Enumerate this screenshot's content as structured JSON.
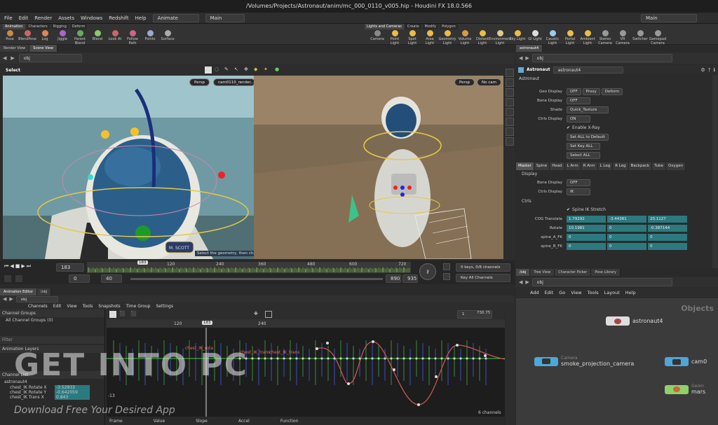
{
  "window": {
    "title": "/Volumes/Projects/Astronaut/anim/mc_000_0110_v005.hip - Houdini FX 18.0.566"
  },
  "menu": {
    "items": [
      "File",
      "Edit",
      "Render",
      "Assets",
      "Windows",
      "Redshift",
      "Help"
    ],
    "desktop": "Animate",
    "main_left": "Main",
    "main_right": "Main"
  },
  "shelf": {
    "tabs_left": [
      "Animation",
      "Characters",
      "Rigging",
      "Deform"
    ],
    "tools_left": [
      "Pose",
      "BlendPose",
      "Log",
      "Jiggle",
      "Parent Blend",
      "Blend",
      "Look At",
      "Follow Path",
      "Points",
      "Surface"
    ],
    "tabs_right": [
      "Lights and Cameras",
      "Create",
      "Modify",
      "Polygon"
    ],
    "tools_right": [
      "Camera",
      "Point Light",
      "Spot Light",
      "Area Light",
      "Geometry Light",
      "Volume Light",
      "Distant Light",
      "Environment Light",
      "Sky Light",
      "GI Light",
      "Caustic Light",
      "Portal Light",
      "Ambient Light",
      "Stereo Camera",
      "VR Camera",
      "Switcher",
      "Gamepad Camera"
    ]
  },
  "viewport": {
    "tabs": [
      "Render View",
      "Scene View"
    ],
    "path": "obj",
    "mode": "Select",
    "left_persp": "Persp",
    "left_cam": "cam0110_render...",
    "right_persp": "Persp",
    "right_cam": "No cam",
    "status": "Select the geometry, then choose an operation to perform."
  },
  "timeline": {
    "current_frame": "183",
    "ticks": [
      "120",
      "240",
      "360",
      "480",
      "600",
      "720"
    ],
    "start": "0",
    "start2": "40",
    "end1": "890",
    "end2": "935",
    "keys_info": "0 keys, 0/6 channels",
    "key_all": "Key All Channels"
  },
  "anim_editor": {
    "tabs": [
      "Animation Editor",
      "/obj"
    ],
    "path": "obj",
    "menu": [
      "Channels",
      "Edit",
      "View",
      "Tools",
      "Snapshots",
      "Time Group",
      "Settings"
    ],
    "channel_groups": "Channel Groups",
    "all_groups": "All Channel Groups (0)",
    "filter": "Filter",
    "layers": "Animation Layers",
    "channel_list": "Channel List",
    "node": "astronaut4",
    "channels": [
      {
        "name": "chest_IK Rotate X",
        "value": "-3.52933"
      },
      {
        "name": "chest_IK Rotate Y",
        "value": "-0.642059"
      },
      {
        "name": "chest_IK Trans X",
        "value": "0.843"
      }
    ],
    "graph_start": "1",
    "graph_end": "730.75",
    "graph_frame": "183",
    "graph_ticks": [
      "120",
      "240"
    ],
    "curve_label1": "chest_IK_rota",
    "curve_label2": "chest_IK_trans",
    "curve_label3": "chest_IK_trans",
    "y_value": "-13",
    "channel_count": "6 channels",
    "bottom": [
      "Frame",
      "Value",
      "Slope",
      "Accel",
      "Function"
    ]
  },
  "params": {
    "tab": "astronaut4",
    "type": "Astronaut",
    "node": "astronaut4",
    "section": "Astronaut",
    "geo_display_label": "Geo Display",
    "geo_display": [
      "OFF",
      "Proxy",
      "Deform"
    ],
    "bone_display_label": "Bone Display",
    "bone_display": "OFF",
    "shade_label": "Shade",
    "shade": "Quick_Texture",
    "ctrls_display_label": "Ctrls Display",
    "ctrls_display": "ON",
    "xray": "Enable X-Ray",
    "set_all_default": "Set ALL to Default",
    "set_key_all": "Set Key ALL",
    "select_all": "Select ALL",
    "tabs": [
      "Master",
      "Spine",
      "Head",
      "L Arm",
      "R Arm",
      "L Leg",
      "R Leg",
      "Backpack",
      "Tube",
      "Oxygen"
    ],
    "display_section": "Display",
    "bone_display2": "OFF",
    "ctrls_display2": "IK",
    "ctrls_section": "Ctrls",
    "spine_ik": "Spine IK Stretch",
    "cog_translate": {
      "label": "COG Translate",
      "x": "1.79292",
      "y": "-3.44381",
      "z": "20.1127"
    },
    "rotate": {
      "label": "Rotate",
      "x": "10.1981",
      "y": "0",
      "z": "-0.387144"
    },
    "spine_a": {
      "label": "spine_A_FK",
      "x": "0",
      "y": "0",
      "z": "0"
    },
    "spine_b": {
      "label": "spine_B_FK",
      "x": "0",
      "y": "0",
      "z": "0"
    }
  },
  "network": {
    "tabs": [
      "/obj",
      "Tree View",
      "Character Picker",
      "Pose Library"
    ],
    "path": "obj",
    "menu": [
      "Add",
      "Edit",
      "Go",
      "View",
      "Tools",
      "Layout",
      "Help"
    ],
    "title": "Objects",
    "nodes": [
      {
        "type": "",
        "name": "astronaut4"
      },
      {
        "type": "Camera",
        "name": "smoke_projection_camera"
      },
      {
        "type": "",
        "name": "cam0"
      },
      {
        "type": "Geom",
        "name": "mars"
      }
    ]
  },
  "watermark": {
    "main": "GET INTO PC",
    "sub": "Download Free Your Desired App"
  }
}
